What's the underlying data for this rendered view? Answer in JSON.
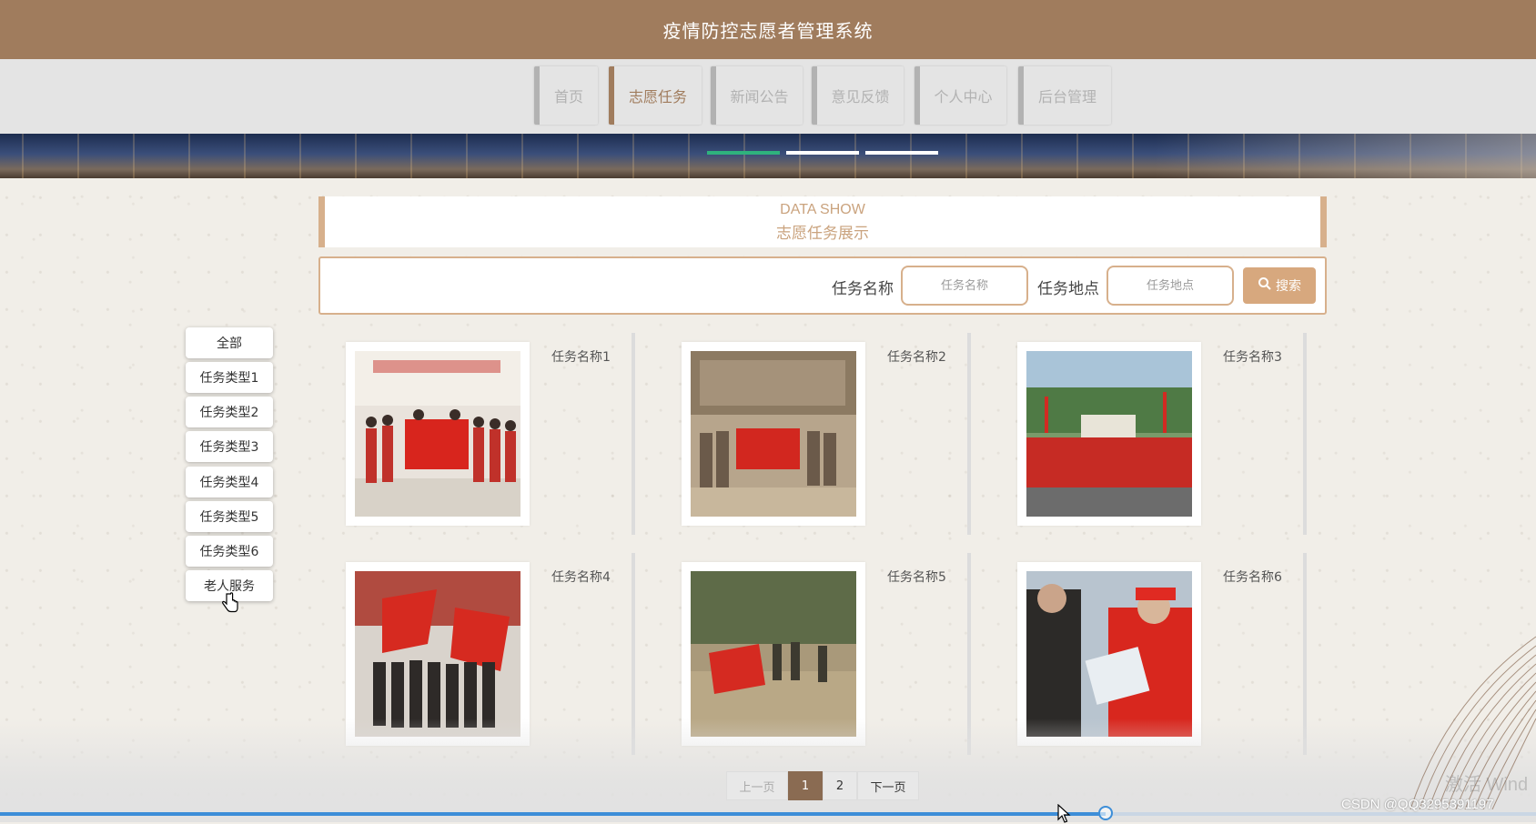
{
  "header": {
    "title": "疫情防控志愿者管理系统"
  },
  "nav": {
    "items": [
      {
        "label": "首页",
        "active": false
      },
      {
        "label": "志愿任务",
        "active": true
      },
      {
        "label": "新闻公告",
        "active": false
      },
      {
        "label": "意见反馈",
        "active": false
      },
      {
        "label": "个人中心",
        "active": false
      },
      {
        "label": "后台管理",
        "active": false
      }
    ]
  },
  "banner": {
    "slides": 3,
    "active_slide": 1
  },
  "section": {
    "title_en": "DATA SHOW",
    "title_cn": "志愿任务展示"
  },
  "search": {
    "name_label": "任务名称",
    "name_placeholder": "任务名称",
    "location_label": "任务地点",
    "location_placeholder": "任务地点",
    "button_label": "搜索"
  },
  "categories": [
    "全部",
    "任务类型1",
    "任务类型2",
    "任务类型3",
    "任务类型4",
    "任务类型5",
    "任务类型6",
    "老人服务"
  ],
  "tasks": [
    {
      "title": "任务名称1"
    },
    {
      "title": "任务名称2"
    },
    {
      "title": "任务名称3"
    },
    {
      "title": "任务名称4"
    },
    {
      "title": "任务名称5"
    },
    {
      "title": "任务名称6"
    }
  ],
  "pagination": {
    "prev": "上一页",
    "pages": [
      "1",
      "2"
    ],
    "current": "1",
    "next": "下一页"
  },
  "video": {
    "progress": 0.72
  },
  "watermark": "CSDN @QQ3295391197",
  "watermark_faint": "激活 Wind",
  "colors": {
    "header": "#a07c5d",
    "accent": "#d7b08c",
    "slide_active": "#2fb27d",
    "page_active": "#8a6b52"
  }
}
